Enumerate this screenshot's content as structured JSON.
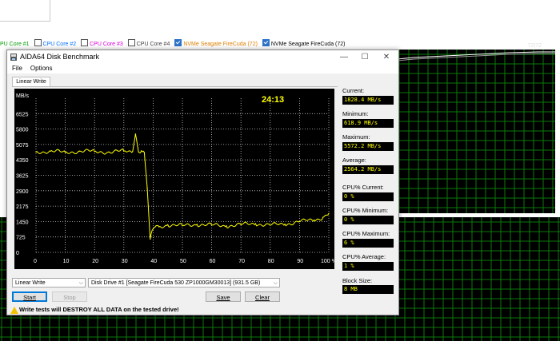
{
  "legend": [
    {
      "label": "PU Core #1",
      "color": "#00a000",
      "checked": false,
      "cb": false
    },
    {
      "label": "CPU Core #2",
      "color": "#0070ff",
      "checked": false,
      "cb": true
    },
    {
      "label": "CPU Core #3",
      "color": "#e000e0",
      "checked": false,
      "cb": true
    },
    {
      "label": "CPU Core #4",
      "color": "#404040",
      "checked": false,
      "cb": true
    },
    {
      "label": "NVMe Seagate FireCuda (72)",
      "color": "#e08000",
      "checked": true,
      "cb": true
    },
    {
      "label": "NVMe Seagate FireCuda (72)",
      "color": "#000000",
      "checked": true,
      "cb": true
    }
  ],
  "bg_graph_value": "72|72",
  "window": {
    "title": "AIDA64 Disk Benchmark",
    "minimize": "—",
    "maximize": "☐",
    "close": "✕"
  },
  "menu": {
    "file": "File",
    "options": "Options"
  },
  "tab": "Linear Write",
  "chart_data": {
    "type": "line",
    "title": "",
    "timer": "24:13",
    "ylabel": "MB/s",
    "y_ticks": [
      "0",
      "725",
      "1450",
      "2175",
      "2900",
      "3625",
      "4350",
      "5075",
      "5800",
      "6525"
    ],
    "x_ticks": [
      "0",
      "10",
      "20",
      "30",
      "40",
      "50",
      "60",
      "70",
      "80",
      "90",
      "100 %"
    ],
    "ylim": [
      0,
      7250
    ],
    "xlim": [
      0,
      100
    ],
    "series": [
      {
        "color": "#ffff00",
        "x": [
          0,
          5,
          10,
          15,
          20,
          25,
          30,
          33,
          34,
          35,
          36,
          37,
          38,
          39,
          40,
          41,
          42,
          45,
          50,
          55,
          60,
          65,
          70,
          75,
          80,
          85,
          90,
          95,
          98,
          100
        ],
        "y": [
          4720,
          4760,
          4700,
          4760,
          4740,
          4720,
          4760,
          4740,
          5572,
          4730,
          4780,
          4700,
          3000,
          619,
          1100,
          1250,
          1200,
          1300,
          1250,
          1320,
          1280,
          1250,
          1300,
          1350,
          1280,
          1330,
          1450,
          1520,
          1650,
          1830
        ]
      }
    ]
  },
  "stats": {
    "current_label": "Current:",
    "current": "1828.4 MB/s",
    "minimum_label": "Minimum:",
    "minimum": "618.9 MB/s",
    "maximum_label": "Maximum:",
    "maximum": "5572.2 MB/s",
    "average_label": "Average:",
    "average": "2564.2 MB/s",
    "cpu_current_label": "CPU% Current:",
    "cpu_current": "0 %",
    "cpu_minimum_label": "CPU% Minimum:",
    "cpu_minimum": "0 %",
    "cpu_maximum_label": "CPU% Maximum:",
    "cpu_maximum": "6 %",
    "cpu_average_label": "CPU% Average:",
    "cpu_average": "1 %",
    "block_size_label": "Block Size:",
    "block_size": "8 MB"
  },
  "controls": {
    "test_select": "Linear Write",
    "drive_select": "Disk Drive #1  [Seagate FireCuda 530 ZP1000GM30013]  (931.5 GB)",
    "start": "Start",
    "stop": "Stop",
    "save": "Save",
    "clear": "Clear"
  },
  "warning": "Write tests will DESTROY ALL DATA on the tested drive!"
}
